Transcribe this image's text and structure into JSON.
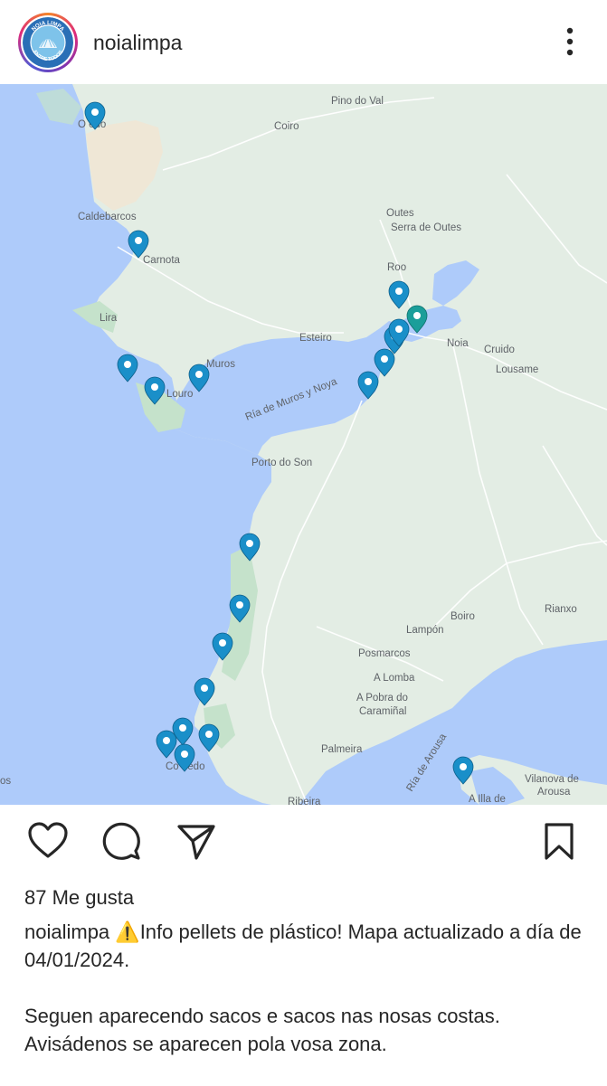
{
  "header": {
    "username": "noialimpa",
    "avatar_text_top": "NOIA LIMPA",
    "avatar_text_bottom": "ENTRE TODOS",
    "more_icon": "vertical-ellipsis-icon"
  },
  "map": {
    "labels": {
      "pino_do_val": "Pino do Val",
      "coiro": "Coiro",
      "oviedo": "O   edo",
      "caldebarcos": "Caldebarcos",
      "carnota": "Carnota",
      "outes": "Outes",
      "serra_de_outes": "Serra de Outes",
      "roo": "Roo",
      "lira": "Lira",
      "esteiro": "Esteiro",
      "noia": "Noia",
      "cruido": "Cruido",
      "lousame": "Lousame",
      "muros": "Muros",
      "louro": "Louro",
      "ria_muros_noia": "Ría de Muros y Noya",
      "porto_do_son": "Porto do Son",
      "rianxo": "Rianxo",
      "boiro": "Boiro",
      "lampon": "Lampón",
      "posmarcos": "Posmarcos",
      "a_lomba": "A Lomba",
      "a_pobra_1": "A Pobra do",
      "a_pobra_2": "Caramiñal",
      "palmeira": "Palmeira",
      "ria_arousa": "Ría de Arousa",
      "vilanova_1": "Vilanova de",
      "vilanova_2": "Arousa",
      "a_illa": "A Illa de",
      "ribeira": "Ribeira",
      "corrubedo": "Co    bedo",
      "os": "os"
    },
    "pin_color": "#1a8fc9",
    "pin_highlight_color": "#1b9e9a",
    "water_color": "#aecbfa",
    "land_color": "#e1ece3"
  },
  "actions": {
    "like_icon": "heart-icon",
    "comment_icon": "comment-icon",
    "share_icon": "send-icon",
    "save_icon": "bookmark-icon"
  },
  "post": {
    "likes": "87 Me gusta",
    "caption_user": "noialimpa",
    "caption_line1": "⚠️Info pellets de plástico! Mapa actualizado a día de 04/01/2024.",
    "caption_line2": "Seguen aparecendo sacos e sacos nas nosas costas. Avisádenos se aparecen pola vosa zona."
  }
}
